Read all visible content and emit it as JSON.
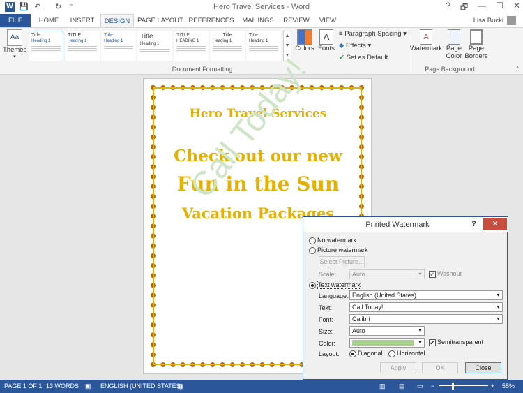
{
  "window": {
    "title": "Hero Travel Services - Word",
    "app_logo": "W",
    "user": "Lisa Bucki"
  },
  "quick_access": {
    "save": "💾",
    "undo": "↶",
    "redo": "↻",
    "customize": "⁼"
  },
  "window_controls": {
    "help": "?",
    "restore": "🗗",
    "minimize": "—",
    "maximize": "☐",
    "close": "✕"
  },
  "tabs": [
    "FILE",
    "HOME",
    "INSERT",
    "DESIGN",
    "PAGE LAYOUT",
    "REFERENCES",
    "MAILINGS",
    "REVIEW",
    "VIEW"
  ],
  "ribbon": {
    "themes": "Themes",
    "style_sets": [
      "Title",
      "TITLE",
      "Title",
      "Title",
      "TITLE",
      "Title",
      "Title"
    ],
    "style_headings": [
      "Heading 1",
      "Heading 1",
      "Heading 1",
      "Heading 1",
      "HEADING 1",
      "Heading 1",
      "Heading 1"
    ],
    "colors": "Colors",
    "fonts": "Fonts",
    "paragraph_spacing": "Paragraph Spacing",
    "effects": "Effects",
    "set_default": "Set as Default",
    "group_document_formatting": "Document Formatting",
    "watermark": "Watermark",
    "page_color": "Page Color",
    "page_borders": "Page Borders",
    "group_page_background": "Page Background"
  },
  "document": {
    "line1": "Hero Travel Services",
    "line2": "Check out our new",
    "line3": "Fun in the Sun",
    "line4": "Vacation Packages",
    "watermark": "Call Today!"
  },
  "dialog": {
    "title": "Printed Watermark",
    "help": "?",
    "no_watermark": "No watermark",
    "picture_watermark": "Picture watermark",
    "select_picture": "Select Picture...",
    "scale_label": "Scale:",
    "scale_value": "Auto",
    "washout": "Washout",
    "text_watermark": "Text watermark",
    "language_label": "Language:",
    "language_value": "English (United States)",
    "text_label": "Text:",
    "text_value": "Call Today!",
    "font_label": "Font:",
    "font_value": "Calibri",
    "size_label": "Size:",
    "size_value": "Auto",
    "color_label": "Color:",
    "color_value": "#a8d08d",
    "semitransparent": "Semitransparent",
    "layout_label": "Layout:",
    "diagonal": "Diagonal",
    "horizontal": "Horizontal",
    "apply": "Apply",
    "ok": "OK",
    "close": "Close"
  },
  "status": {
    "page": "PAGE 1 OF 1",
    "words": "13 WORDS",
    "language": "ENGLISH (UNITED STATES)",
    "zoom": "55%"
  }
}
